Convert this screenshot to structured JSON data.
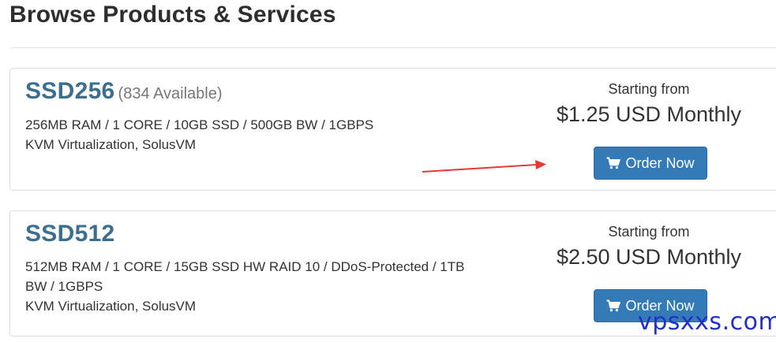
{
  "page": {
    "title": "Browse Products & Services"
  },
  "products": [
    {
      "name": "SSD256",
      "availability": "(834 Available)",
      "description_lines": [
        "256MB RAM / 1 CORE / 10GB SSD / 500GB BW / 1GBPS",
        "KVM Virtualization, SolusVM"
      ],
      "starting_label": "Starting from",
      "price": "$1.25 USD Monthly",
      "order_label": "Order Now"
    },
    {
      "name": "SSD512",
      "availability": "",
      "description_lines": [
        "512MB RAM / 1 CORE / 15GB SSD HW RAID 10 / DDoS-Protected / 1TB",
        "BW / 1GBPS",
        "KVM Virtualization, SolusVM"
      ],
      "starting_label": "Starting from",
      "price": "$2.50 USD Monthly",
      "order_label": "Order Now"
    }
  ],
  "icons": {
    "order_button_icon": "shopping-cart-icon",
    "annotation": "red-arrow-icon"
  },
  "watermark": {
    "text": "vpsxxs.com",
    "color": "#2230c8"
  },
  "colors": {
    "product_name": "#3c6e8f",
    "button_bg": "#337ab7",
    "arrow": "#e53935"
  }
}
